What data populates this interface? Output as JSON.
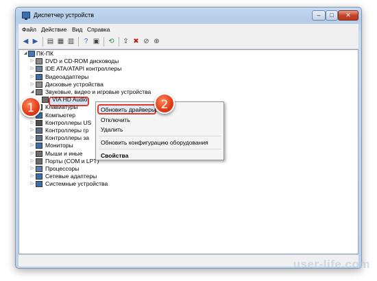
{
  "window": {
    "title": "Диспетчер устройств"
  },
  "menu": [
    "Файл",
    "Действие",
    "Вид",
    "Справка"
  ],
  "tree": {
    "root": "ПК-ПК",
    "items": [
      {
        "label": "DVD и CD-ROM дисководы",
        "icon": "dvd-drive-icon"
      },
      {
        "label": "IDE ATA/ATAPI контроллеры",
        "icon": "ide-controller-icon"
      },
      {
        "label": "Видеоадаптеры",
        "icon": "display-adapter-icon"
      },
      {
        "label": "Дисковые устройства",
        "icon": "disk-drive-icon"
      },
      {
        "label": "Звуковые, видео и игровые устройства",
        "icon": "sound-device-icon"
      },
      {
        "label": "VIA HD Audio",
        "icon": "speaker-icon"
      },
      {
        "label": "Клавиатуры",
        "icon": "keyboard-icon"
      },
      {
        "label": "Компьютер",
        "icon": "computer-icon"
      },
      {
        "label": "Контроллеры US",
        "icon": "usb-controller-icon"
      },
      {
        "label": "Контроллеры гр",
        "icon": "storage-controller-icon"
      },
      {
        "label": "Контроллеры за",
        "icon": "storage-controller-icon"
      },
      {
        "label": "Мониторы",
        "icon": "monitor-icon"
      },
      {
        "label": "Мыши и иные",
        "icon": "mouse-icon"
      },
      {
        "label": "Порты (COM и LPT)",
        "icon": "port-icon"
      },
      {
        "label": "Процессоры",
        "icon": "processor-icon"
      },
      {
        "label": "Сетевые адаптеры",
        "icon": "network-adapter-icon"
      },
      {
        "label": "Системные устройства",
        "icon": "system-device-icon"
      }
    ]
  },
  "context_menu": {
    "update": "Обновить драйверы...",
    "disable": "Отключить",
    "delete": "Удалить",
    "scan": "Обновить конфигурацию оборудования",
    "properties": "Свойства"
  },
  "badges": [
    "1",
    "2"
  ],
  "watermark": "user-life.com",
  "colors": {
    "accent_red": "#e0382b",
    "title_gradient": "#c6daf0"
  }
}
